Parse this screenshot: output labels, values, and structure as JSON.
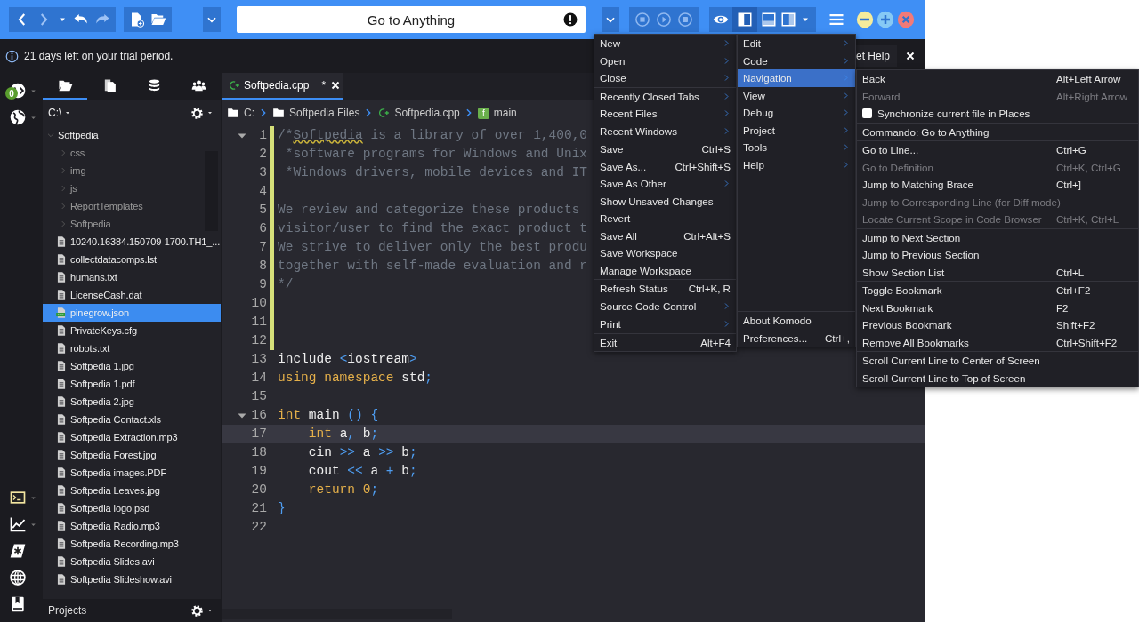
{
  "toolbar": {
    "nav_buttons": [
      {
        "kind": "back",
        "disabled": false
      },
      {
        "kind": "forward",
        "disabled": true
      },
      {
        "kind": "history",
        "disabled": false
      },
      {
        "kind": "undo",
        "disabled": false
      },
      {
        "kind": "redo",
        "disabled": true
      }
    ],
    "go_to": {
      "placeholder": "Go to Anything"
    },
    "run_controls": {
      "disabled": true
    },
    "panes": [
      {
        "selected": true
      },
      {
        "selected": false
      },
      {
        "selected": false
      }
    ]
  },
  "notice": {
    "text": "21 days left on your trial period.",
    "help_button": "et Help"
  },
  "rail": {
    "badge": "0"
  },
  "sidebar": {
    "tabs": [
      {
        "selected": true
      },
      {
        "selected": false
      },
      {
        "selected": false
      },
      {
        "selected": false
      }
    ],
    "path": "C:\\",
    "tree": [
      {
        "label": "Softpedia",
        "kind": "folder",
        "expanded": true,
        "selected": false,
        "children": [
          {
            "label": "css",
            "kind": "folder",
            "expanded": false,
            "selected": false
          },
          {
            "label": "img",
            "kind": "folder",
            "expanded": false,
            "selected": false
          },
          {
            "label": "js",
            "kind": "folder",
            "expanded": false,
            "selected": false
          },
          {
            "label": "ReportTemplates",
            "kind": "folder",
            "expanded": false,
            "selected": false
          },
          {
            "label": "Softpedia",
            "kind": "folder",
            "expanded": false,
            "selected": false
          },
          {
            "label": "10240.16384.150709-1700.TH1_...",
            "kind": "file",
            "selected": false
          },
          {
            "label": "collectdatacomps.lst",
            "kind": "file",
            "selected": false
          },
          {
            "label": "humans.txt",
            "kind": "file",
            "selected": false
          },
          {
            "label": "LicenseCash.dat",
            "kind": "file",
            "selected": false
          },
          {
            "label": "pinegrow.json",
            "kind": "json",
            "selected": true
          },
          {
            "label": "PrivateKeys.cfg",
            "kind": "file",
            "selected": false
          },
          {
            "label": "robots.txt",
            "kind": "file",
            "selected": false
          },
          {
            "label": "Softpedia 1.jpg",
            "kind": "file",
            "selected": false
          },
          {
            "label": "Softpedia 1.pdf",
            "kind": "file",
            "selected": false
          },
          {
            "label": "Softpedia 2.jpg",
            "kind": "file",
            "selected": false
          },
          {
            "label": "Softpedia Contact.xls",
            "kind": "file",
            "selected": false
          },
          {
            "label": "Softpedia Extraction.mp3",
            "kind": "file",
            "selected": false
          },
          {
            "label": "Softpedia Forest.jpg",
            "kind": "file",
            "selected": false
          },
          {
            "label": "Softpedia images.PDF",
            "kind": "file",
            "selected": false
          },
          {
            "label": "Softpedia Leaves.jpg",
            "kind": "file",
            "selected": false
          },
          {
            "label": "Softpedia logo.psd",
            "kind": "file",
            "selected": false
          },
          {
            "label": "Softpedia Radio.mp3",
            "kind": "file",
            "selected": false
          },
          {
            "label": "Softpedia Recording.mp3",
            "kind": "file",
            "selected": false
          },
          {
            "label": "Softpedia Slides.avi",
            "kind": "file",
            "selected": false
          },
          {
            "label": "Softpedia Slideshow.avi",
            "kind": "file",
            "selected": false
          }
        ]
      }
    ],
    "footer": "Projects"
  },
  "editor": {
    "tab": {
      "title": "Softpedia.cpp",
      "modified": "*"
    },
    "breadcrumb": [
      {
        "kind": "folder",
        "label": "C:"
      },
      {
        "kind": "folder",
        "label": "Softpedia Files"
      },
      {
        "kind": "cpp",
        "label": "Softpedia.cpp"
      },
      {
        "kind": "function",
        "badge": "f",
        "label": "main"
      }
    ],
    "lines": [
      {
        "n": "1",
        "fold": true,
        "changed": true,
        "current": false,
        "tokens": [
          {
            "text": "/*",
            "kind": "comment"
          },
          {
            "text": "Softpedia",
            "kind": "spell"
          },
          {
            "text": " is a library of over 1,400,0",
            "kind": "comment"
          }
        ]
      },
      {
        "n": "2",
        "fold": false,
        "changed": true,
        "current": false,
        "tokens": [
          {
            "text": " *software programs for Windows and Unix",
            "kind": "comment"
          }
        ]
      },
      {
        "n": "3",
        "fold": false,
        "changed": true,
        "current": false,
        "tokens": [
          {
            "text": " *Windows drivers, mobile devices and IT",
            "kind": "comment"
          }
        ]
      },
      {
        "n": "4",
        "fold": false,
        "changed": true,
        "current": false
      },
      {
        "n": "5",
        "fold": false,
        "changed": true,
        "current": false,
        "tokens": [
          {
            "text": "We review and categorize these products",
            "kind": "comment"
          }
        ]
      },
      {
        "n": "6",
        "fold": false,
        "changed": true,
        "current": false,
        "tokens": [
          {
            "text": "visitor/user to find the exact product t",
            "kind": "comment"
          }
        ]
      },
      {
        "n": "7",
        "fold": false,
        "changed": true,
        "current": false,
        "tokens": [
          {
            "text": "We strive to deliver only the best produ",
            "kind": "comment"
          }
        ]
      },
      {
        "n": "8",
        "fold": false,
        "changed": true,
        "current": false,
        "tokens": [
          {
            "text": "together with self-made evaluation and r",
            "kind": "comment"
          }
        ]
      },
      {
        "n": "9",
        "fold": false,
        "changed": true,
        "current": false,
        "tokens": [
          {
            "text": "*/",
            "kind": "comment"
          }
        ]
      },
      {
        "n": "10",
        "fold": false,
        "changed": true,
        "current": false
      },
      {
        "n": "11",
        "fold": false,
        "changed": true,
        "current": false
      },
      {
        "n": "12",
        "fold": false,
        "changed": true,
        "current": false
      },
      {
        "n": "13",
        "fold": false,
        "changed": false,
        "current": false,
        "tokens": [
          {
            "text": "include ",
            "kind": "plain"
          },
          {
            "text": "<",
            "kind": "operator"
          },
          {
            "text": "iostream",
            "kind": "plain"
          },
          {
            "text": ">",
            "kind": "operator"
          }
        ]
      },
      {
        "n": "14",
        "fold": false,
        "changed": false,
        "current": false,
        "tokens": [
          {
            "text": "using namespace ",
            "kind": "keyword"
          },
          {
            "text": "std",
            "kind": "plain"
          },
          {
            "text": ";",
            "kind": "operator"
          }
        ]
      },
      {
        "n": "15",
        "fold": false,
        "changed": false,
        "current": false
      },
      {
        "n": "16",
        "fold": true,
        "changed": false,
        "current": false,
        "tokens": [
          {
            "text": "int ",
            "kind": "keyword"
          },
          {
            "text": "main ",
            "kind": "plain"
          },
          {
            "text": "()",
            "kind": "operator"
          },
          {
            "text": " {",
            "kind": "operator"
          }
        ]
      },
      {
        "n": "17",
        "fold": false,
        "changed": false,
        "current": true,
        "tokens": [
          {
            "text": "    int ",
            "kind": "keyword"
          },
          {
            "text": "a",
            "kind": "plain"
          },
          {
            "text": ",",
            "kind": "operator"
          },
          {
            "text": " b",
            "kind": "plain"
          },
          {
            "text": ";",
            "kind": "operator"
          }
        ]
      },
      {
        "n": "18",
        "fold": false,
        "changed": false,
        "current": false,
        "tokens": [
          {
            "text": "    cin ",
            "kind": "plain"
          },
          {
            "text": ">>",
            "kind": "operator"
          },
          {
            "text": " a ",
            "kind": "plain"
          },
          {
            "text": ">>",
            "kind": "operator"
          },
          {
            "text": " b",
            "kind": "plain"
          },
          {
            "text": ";",
            "kind": "operator"
          }
        ]
      },
      {
        "n": "19",
        "fold": false,
        "changed": false,
        "current": false,
        "tokens": [
          {
            "text": "    cout ",
            "kind": "plain"
          },
          {
            "text": "<<",
            "kind": "operator"
          },
          {
            "text": " a ",
            "kind": "plain"
          },
          {
            "text": "+",
            "kind": "operator"
          },
          {
            "text": " b",
            "kind": "plain"
          },
          {
            "text": ";",
            "kind": "operator"
          }
        ]
      },
      {
        "n": "20",
        "fold": false,
        "changed": false,
        "current": false,
        "tokens": [
          {
            "text": "    return ",
            "kind": "keyword"
          },
          {
            "text": "0",
            "kind": "number"
          },
          {
            "text": ";",
            "kind": "operator"
          }
        ]
      },
      {
        "n": "21",
        "fold": false,
        "changed": false,
        "current": false,
        "tokens": [
          {
            "text": "}",
            "kind": "operator"
          }
        ]
      },
      {
        "n": "22",
        "fold": false,
        "changed": false,
        "current": false
      }
    ]
  },
  "menus": [
    {
      "groups": [
        [
          {
            "label": "New",
            "kind": "submenu",
            "selected": false
          },
          {
            "label": "Open",
            "kind": "submenu",
            "selected": false
          },
          {
            "label": "Close",
            "kind": "submenu",
            "selected": false
          }
        ],
        [
          {
            "label": "Recently Closed Tabs",
            "kind": "submenu",
            "selected": false
          },
          {
            "label": "Recent Files",
            "kind": "submenu",
            "selected": false
          },
          {
            "label": "Recent Windows",
            "kind": "submenu",
            "selected": false
          }
        ],
        [
          {
            "label": "Save",
            "kind": "command",
            "shortcut": "Ctrl+S",
            "selected": false
          },
          {
            "label": "Save As...",
            "kind": "command",
            "shortcut": "Ctrl+Shift+S",
            "selected": false
          },
          {
            "label": "Save As Other",
            "kind": "submenu",
            "selected": false
          },
          {
            "label": "Show Unsaved Changes",
            "kind": "command",
            "selected": false
          },
          {
            "label": "Revert",
            "kind": "command",
            "selected": false
          },
          {
            "label": "Save All",
            "kind": "command",
            "shortcut": "Ctrl+Alt+S",
            "selected": false
          },
          {
            "label": "Save Workspace",
            "kind": "command",
            "selected": false
          },
          {
            "label": "Manage Workspace",
            "kind": "command",
            "selected": false
          }
        ],
        [
          {
            "label": "Refresh Status",
            "kind": "command",
            "shortcut": "Ctrl+K, R",
            "selected": false
          },
          {
            "label": "Source Code Control",
            "kind": "submenu",
            "selected": false
          }
        ],
        [
          {
            "label": "Print",
            "kind": "submenu",
            "selected": false
          }
        ],
        [
          {
            "label": "Exit",
            "kind": "command",
            "shortcut": "Alt+F4",
            "selected": false
          }
        ]
      ]
    },
    {
      "groups": [
        [
          {
            "label": "Edit",
            "kind": "submenu",
            "selected": false
          },
          {
            "label": "Code",
            "kind": "submenu",
            "selected": false
          },
          {
            "label": "Navigation",
            "kind": "submenu",
            "selected": true
          },
          {
            "label": "View",
            "kind": "submenu",
            "selected": false
          },
          {
            "label": "Debug",
            "kind": "submenu",
            "selected": false
          },
          {
            "label": "Project",
            "kind": "submenu",
            "selected": false
          },
          {
            "label": "Tools",
            "kind": "submenu",
            "selected": false
          },
          {
            "label": "Help",
            "kind": "submenu",
            "selected": false
          }
        ],
        [
          {
            "label": "About Komodo",
            "kind": "command",
            "selected": false
          },
          {
            "label": "Preferences...",
            "kind": "command",
            "shortcut": "Ctrl+,",
            "selected": false
          }
        ]
      ]
    },
    {
      "groups": [
        [
          {
            "label": "Back",
            "kind": "command",
            "shortcut": "Alt+Left Arrow",
            "disabled": false,
            "selected": false
          },
          {
            "label": "Forward",
            "kind": "command",
            "shortcut": "Alt+Right Arrow",
            "disabled": true,
            "selected": false
          },
          {
            "label": "Synchronize current file in Places",
            "kind": "check",
            "checked": false,
            "disabled": false,
            "selected": false
          }
        ],
        [
          {
            "label": "Commando: Go to Anything",
            "kind": "command",
            "disabled": false,
            "selected": false
          }
        ],
        [
          {
            "label": "Go to Line...",
            "kind": "command",
            "shortcut": "Ctrl+G",
            "disabled": false,
            "selected": false
          },
          {
            "label": "Go to Definition",
            "kind": "command",
            "shortcut": "Ctrl+K, Ctrl+G",
            "disabled": true,
            "selected": false
          },
          {
            "label": "Jump to Matching Brace",
            "kind": "command",
            "shortcut": "Ctrl+]",
            "disabled": false,
            "selected": false
          },
          {
            "label": "Jump to Corresponding Line (for Diff mode)",
            "kind": "command",
            "disabled": true,
            "selected": false
          },
          {
            "label": "Locate Current Scope in Code Browser",
            "kind": "command",
            "shortcut": "Ctrl+K, Ctrl+L",
            "disabled": true,
            "selected": false
          }
        ],
        [
          {
            "label": "Jump to Next Section",
            "kind": "command",
            "disabled": false,
            "selected": false
          },
          {
            "label": "Jump to Previous Section",
            "kind": "command",
            "disabled": false,
            "selected": false
          },
          {
            "label": "Show Section List",
            "kind": "command",
            "shortcut": "Ctrl+L",
            "disabled": false,
            "selected": false
          }
        ],
        [
          {
            "label": "Toggle Bookmark",
            "kind": "command",
            "shortcut": "Ctrl+F2",
            "disabled": false,
            "selected": false
          },
          {
            "label": "Next Bookmark",
            "kind": "command",
            "shortcut": "F2",
            "disabled": false,
            "selected": false
          },
          {
            "label": "Previous Bookmark",
            "kind": "command",
            "shortcut": "Shift+F2",
            "disabled": false,
            "selected": false
          },
          {
            "label": "Remove All Bookmarks",
            "kind": "command",
            "shortcut": "Ctrl+Shift+F2",
            "disabled": false,
            "selected": false
          }
        ],
        [
          {
            "label": "Scroll Current Line to Center of Screen",
            "kind": "command",
            "disabled": false,
            "selected": false
          },
          {
            "label": "Scroll Current Line to Top of Screen",
            "kind": "command",
            "disabled": false,
            "selected": false
          }
        ]
      ]
    }
  ]
}
